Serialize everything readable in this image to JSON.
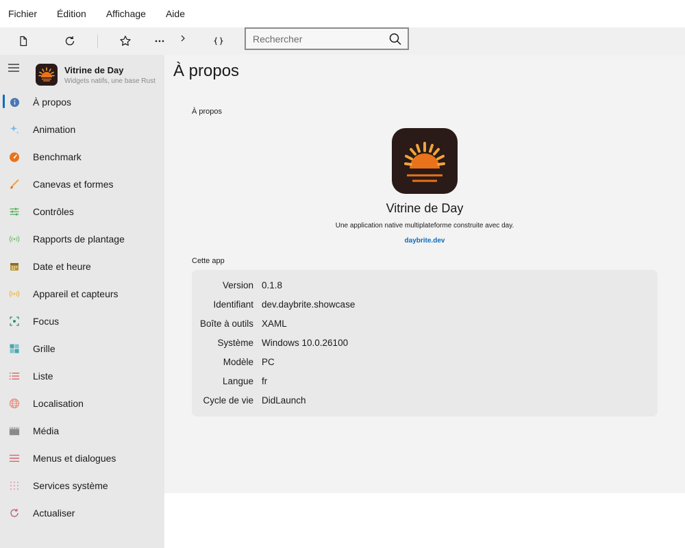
{
  "menubar": [
    "Fichier",
    "Édition",
    "Affichage",
    "Aide"
  ],
  "toolbar": {
    "icons": [
      "new-document-icon",
      "refresh-icon",
      "favorite-star-icon",
      "more-options-icon",
      "chevron-right-icon",
      "braces-icon"
    ],
    "search_placeholder": "Rechercher"
  },
  "sidebar": {
    "app_title": "Vitrine de Day",
    "app_subtitle": "Widgets natifs, une base Rust",
    "items": [
      {
        "label": "À propos",
        "icon": "info-icon",
        "color": "#4a77b4",
        "active": true
      },
      {
        "label": "Animation",
        "icon": "sparkle-icon",
        "color": "#7fb7e6"
      },
      {
        "label": "Benchmark",
        "icon": "gauge-icon",
        "color": "#e8731a"
      },
      {
        "label": "Canevas et formes",
        "icon": "brush-icon",
        "color": "#f0a53a"
      },
      {
        "label": "Contrôles",
        "icon": "sliders-icon",
        "color": "#4caf50"
      },
      {
        "label": "Rapports de plantage",
        "icon": "broadcast-icon",
        "color": "#6abf69"
      },
      {
        "label": "Date et heure",
        "icon": "calendar-icon",
        "color": "#b8953a"
      },
      {
        "label": "Appareil et capteurs",
        "icon": "sensor-icon",
        "color": "#e6b43a"
      },
      {
        "label": "Focus",
        "icon": "focus-icon",
        "color": "#3a8a7a"
      },
      {
        "label": "Grille",
        "icon": "grid-icon",
        "color": "#4aa5b0"
      },
      {
        "label": "Liste",
        "icon": "list-icon",
        "color": "#d9534f"
      },
      {
        "label": "Localisation",
        "icon": "globe-icon",
        "color": "#e88a7a"
      },
      {
        "label": "Média",
        "icon": "clapperboard-icon",
        "color": "#8a8a8a"
      },
      {
        "label": "Menus et dialogues",
        "icon": "menu-icon",
        "color": "#d9606a"
      },
      {
        "label": "Services système",
        "icon": "dots-grid-icon",
        "color": "#e6a0b0"
      },
      {
        "label": "Actualiser",
        "icon": "refresh-icon",
        "color": "#c06080"
      }
    ]
  },
  "main": {
    "page_title": "À propos",
    "section_about": "À propos",
    "app_name": "Vitrine de Day",
    "description": "Une application native multiplateforme construite avec day.",
    "link": "daybrite.dev",
    "section_app": "Cette app",
    "rows": [
      {
        "key": "Version",
        "value": "0.1.8"
      },
      {
        "key": "Identifiant",
        "value": "dev.daybrite.showcase"
      },
      {
        "key": "Boîte à outils",
        "value": "XAML"
      },
      {
        "key": "Système",
        "value": "Windows 10.0.26100"
      },
      {
        "key": "Modèle",
        "value": "PC"
      },
      {
        "key": "Langue",
        "value": "fr"
      },
      {
        "key": "Cycle de vie",
        "value": "DidLaunch"
      }
    ]
  },
  "colors": {
    "accent": "#0f6cbd",
    "logo_bg": "#2a1a18",
    "logo_sun": "#e8731a"
  }
}
